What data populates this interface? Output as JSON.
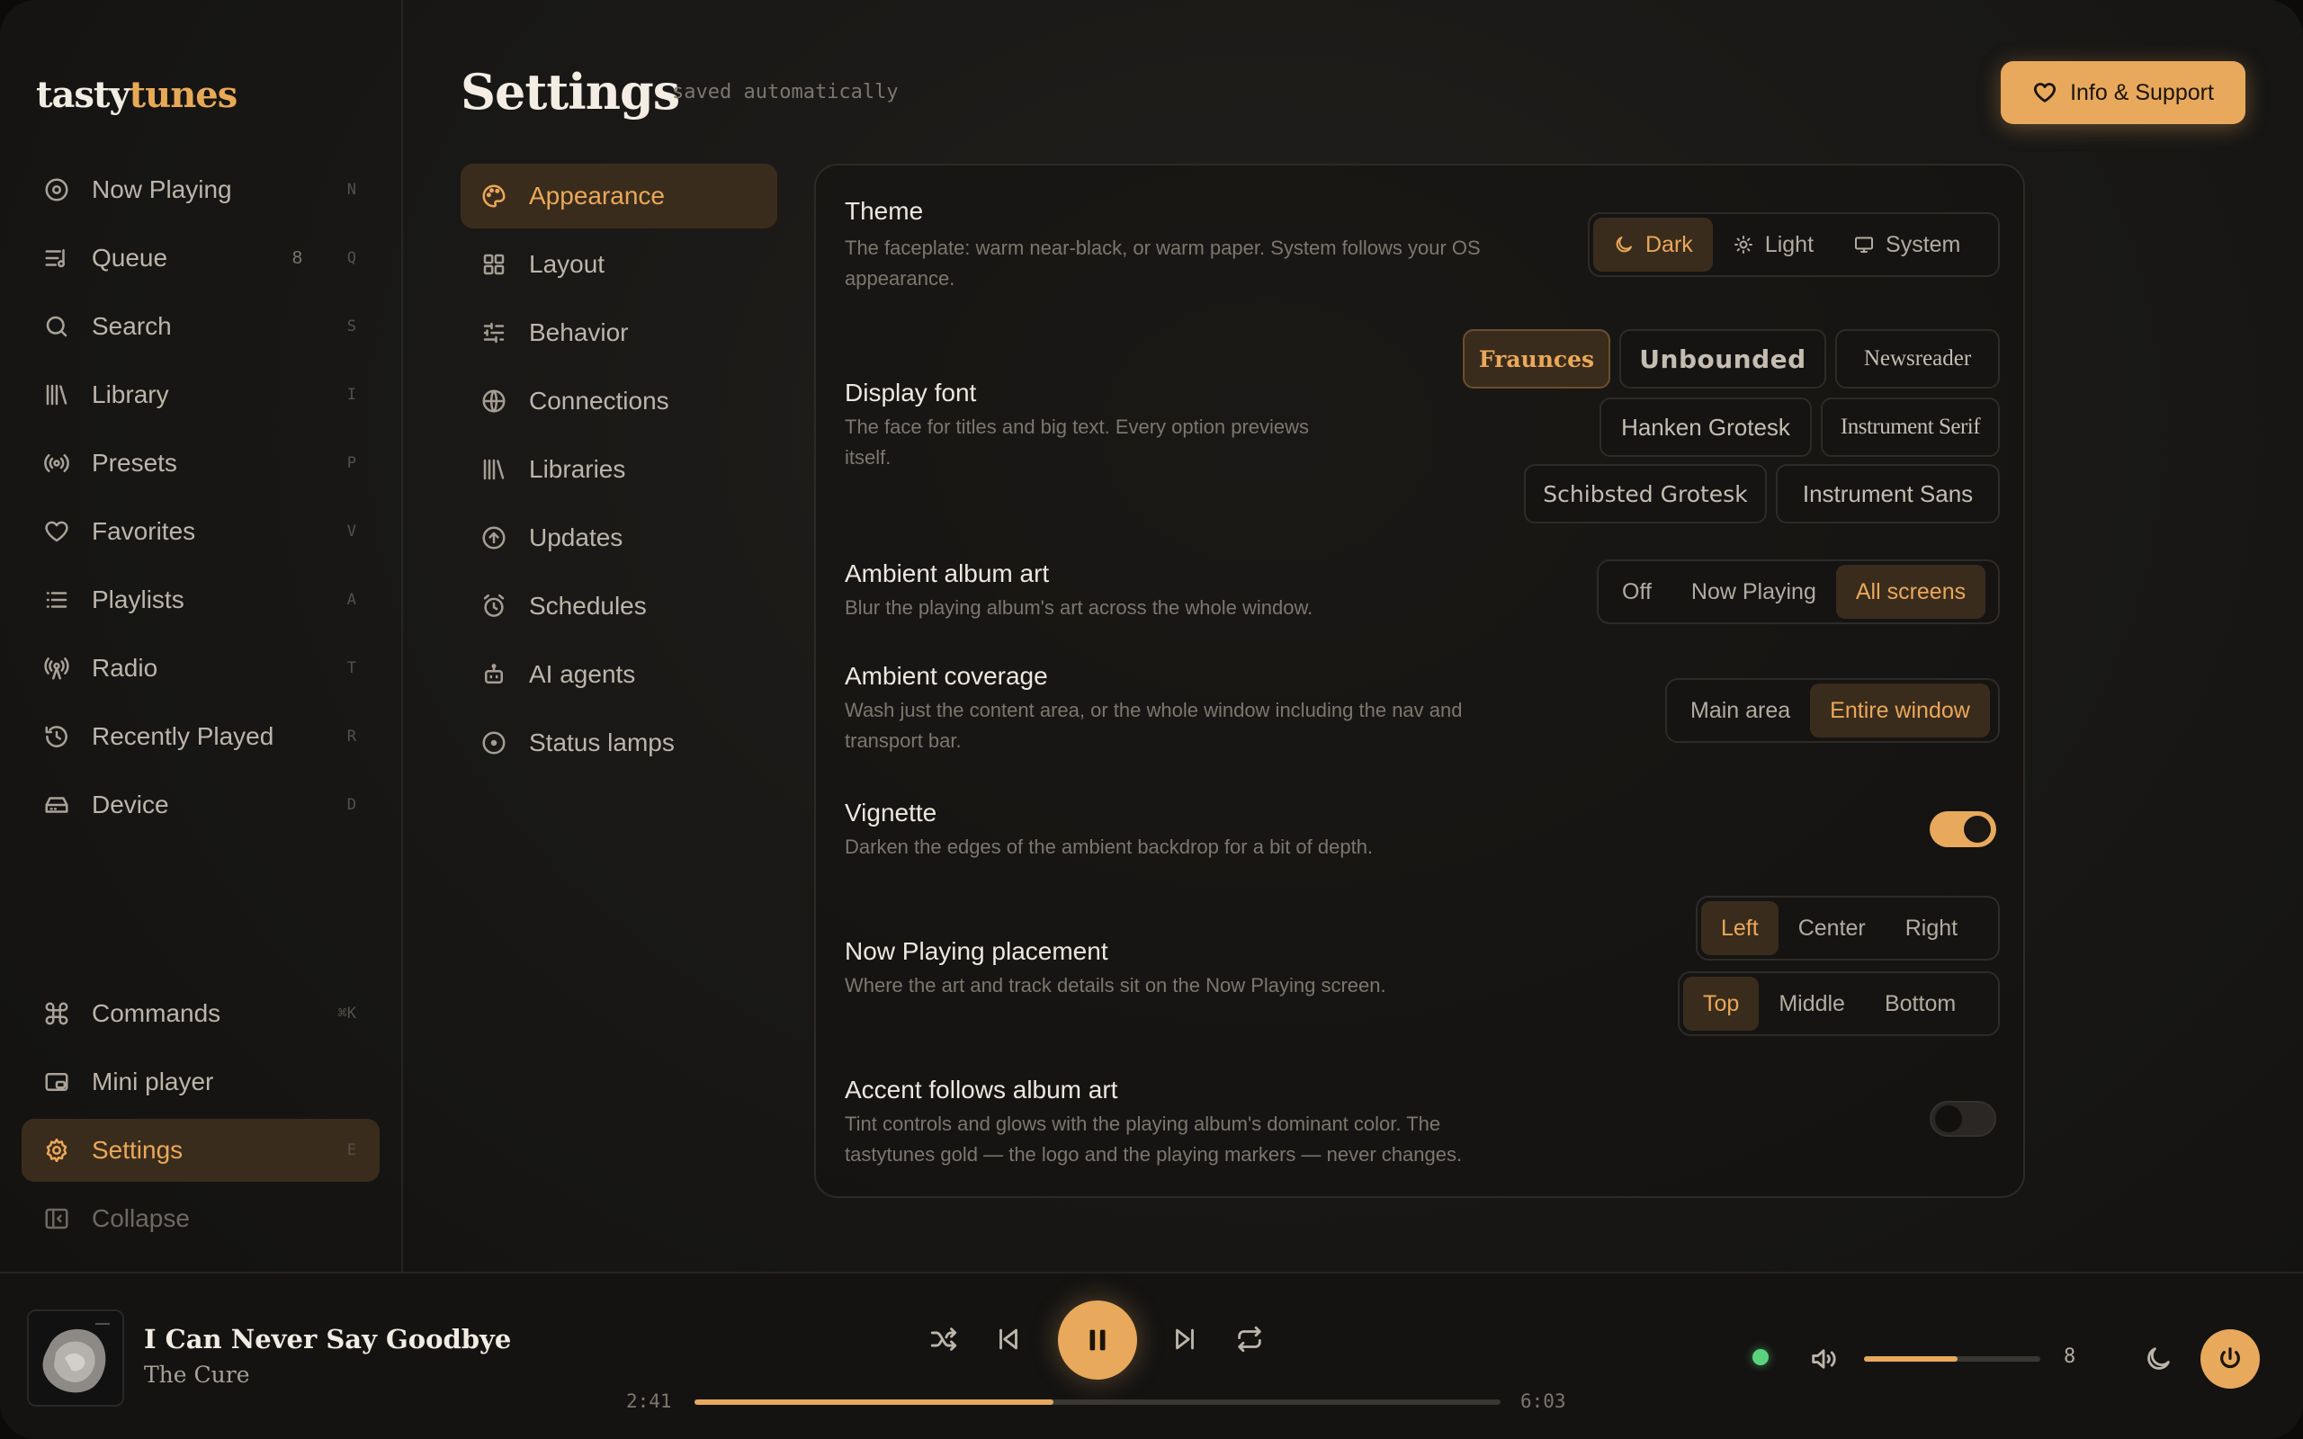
{
  "app": {
    "logo_a": "tasty",
    "logo_b": "tunes"
  },
  "sidebar": {
    "items": [
      {
        "label": "Now Playing",
        "key": "N",
        "icon": "disc-icon"
      },
      {
        "label": "Queue",
        "count": "8",
        "key": "Q",
        "icon": "queue-icon"
      },
      {
        "label": "Search",
        "key": "S",
        "icon": "search-icon"
      },
      {
        "label": "Library",
        "key": "I",
        "icon": "library-icon"
      },
      {
        "label": "Presets",
        "key": "P",
        "icon": "presets-icon"
      },
      {
        "label": "Favorites",
        "key": "V",
        "icon": "heart-icon"
      },
      {
        "label": "Playlists",
        "key": "A",
        "icon": "list-icon"
      },
      {
        "label": "Radio",
        "key": "T",
        "icon": "radio-icon"
      },
      {
        "label": "Recently Played",
        "key": "R",
        "icon": "history-icon"
      },
      {
        "label": "Device",
        "key": "D",
        "icon": "device-icon"
      }
    ],
    "bottom": [
      {
        "label": "Commands",
        "key": "⌘K",
        "icon": "command-icon"
      },
      {
        "label": "Mini player",
        "icon": "mini-player-icon"
      },
      {
        "label": "Settings",
        "key": "E",
        "icon": "gear-icon"
      },
      {
        "label": "Collapse",
        "icon": "collapse-icon"
      }
    ]
  },
  "header": {
    "title": "Settings",
    "saved": "saved automatically",
    "support_label": "Info & Support"
  },
  "settings_nav": [
    {
      "label": "Appearance",
      "icon": "palette-icon"
    },
    {
      "label": "Layout",
      "icon": "grid-icon"
    },
    {
      "label": "Behavior",
      "icon": "sliders-icon"
    },
    {
      "label": "Connections",
      "icon": "globe-icon"
    },
    {
      "label": "Libraries",
      "icon": "library-icon"
    },
    {
      "label": "Updates",
      "icon": "arrow-up-circle-icon"
    },
    {
      "label": "Schedules",
      "icon": "alarm-icon"
    },
    {
      "label": "AI agents",
      "icon": "bot-icon"
    },
    {
      "label": "Status lamps",
      "icon": "lamp-icon"
    }
  ],
  "appearance": {
    "theme": {
      "title": "Theme",
      "desc_1": "The faceplate: warm near-black, or warm paper. System follows your OS",
      "desc_2": "appearance.",
      "options": [
        "Dark",
        "Light",
        "System"
      ],
      "selected": "Dark"
    },
    "display_font": {
      "title": "Display font",
      "desc_1": "The face for titles and big text. Every option previews",
      "desc_2": "itself.",
      "options": [
        "Fraunces",
        "Unbounded",
        "Newsreader",
        "Hanken Grotesk",
        "Instrument Serif",
        "Schibsted Grotesk",
        "Instrument Sans"
      ],
      "selected": "Fraunces"
    },
    "ambient_art": {
      "title": "Ambient album art",
      "desc": "Blur the playing album's art across the whole window.",
      "options": [
        "Off",
        "Now Playing",
        "All screens"
      ],
      "selected": "All screens"
    },
    "ambient_coverage": {
      "title": "Ambient coverage",
      "desc_1": "Wash just the content area, or the whole window including the nav and",
      "desc_2": "transport bar.",
      "options": [
        "Main area",
        "Entire window"
      ],
      "selected": "Entire window"
    },
    "vignette": {
      "title": "Vignette",
      "desc": "Darken the edges of the ambient backdrop for a bit of depth.",
      "enabled": true
    },
    "placement": {
      "title": "Now Playing placement",
      "desc": "Where the art and track details sit on the Now Playing screen.",
      "horizontal": [
        "Left",
        "Center",
        "Right"
      ],
      "horizontal_selected": "Left",
      "vertical": [
        "Top",
        "Middle",
        "Bottom"
      ],
      "vertical_selected": "Top"
    },
    "accent": {
      "title": "Accent follows album art",
      "desc_1": "Tint controls and glows with the playing album's dominant color. The",
      "desc_2": "tastytunes gold — the logo and the playing markers — never changes.",
      "enabled": false
    }
  },
  "player": {
    "title": "I Can Never Say Goodbye",
    "artist": "The Cure",
    "elapsed": "2:41",
    "duration": "6:03",
    "progress_fraction": 0.445,
    "volume": "8",
    "volume_fraction": 0.53,
    "status": "connected"
  },
  "colors": {
    "accent": "#e8a95c",
    "accent_text": "#eaa85a",
    "status_dot": "#5bd37c"
  }
}
